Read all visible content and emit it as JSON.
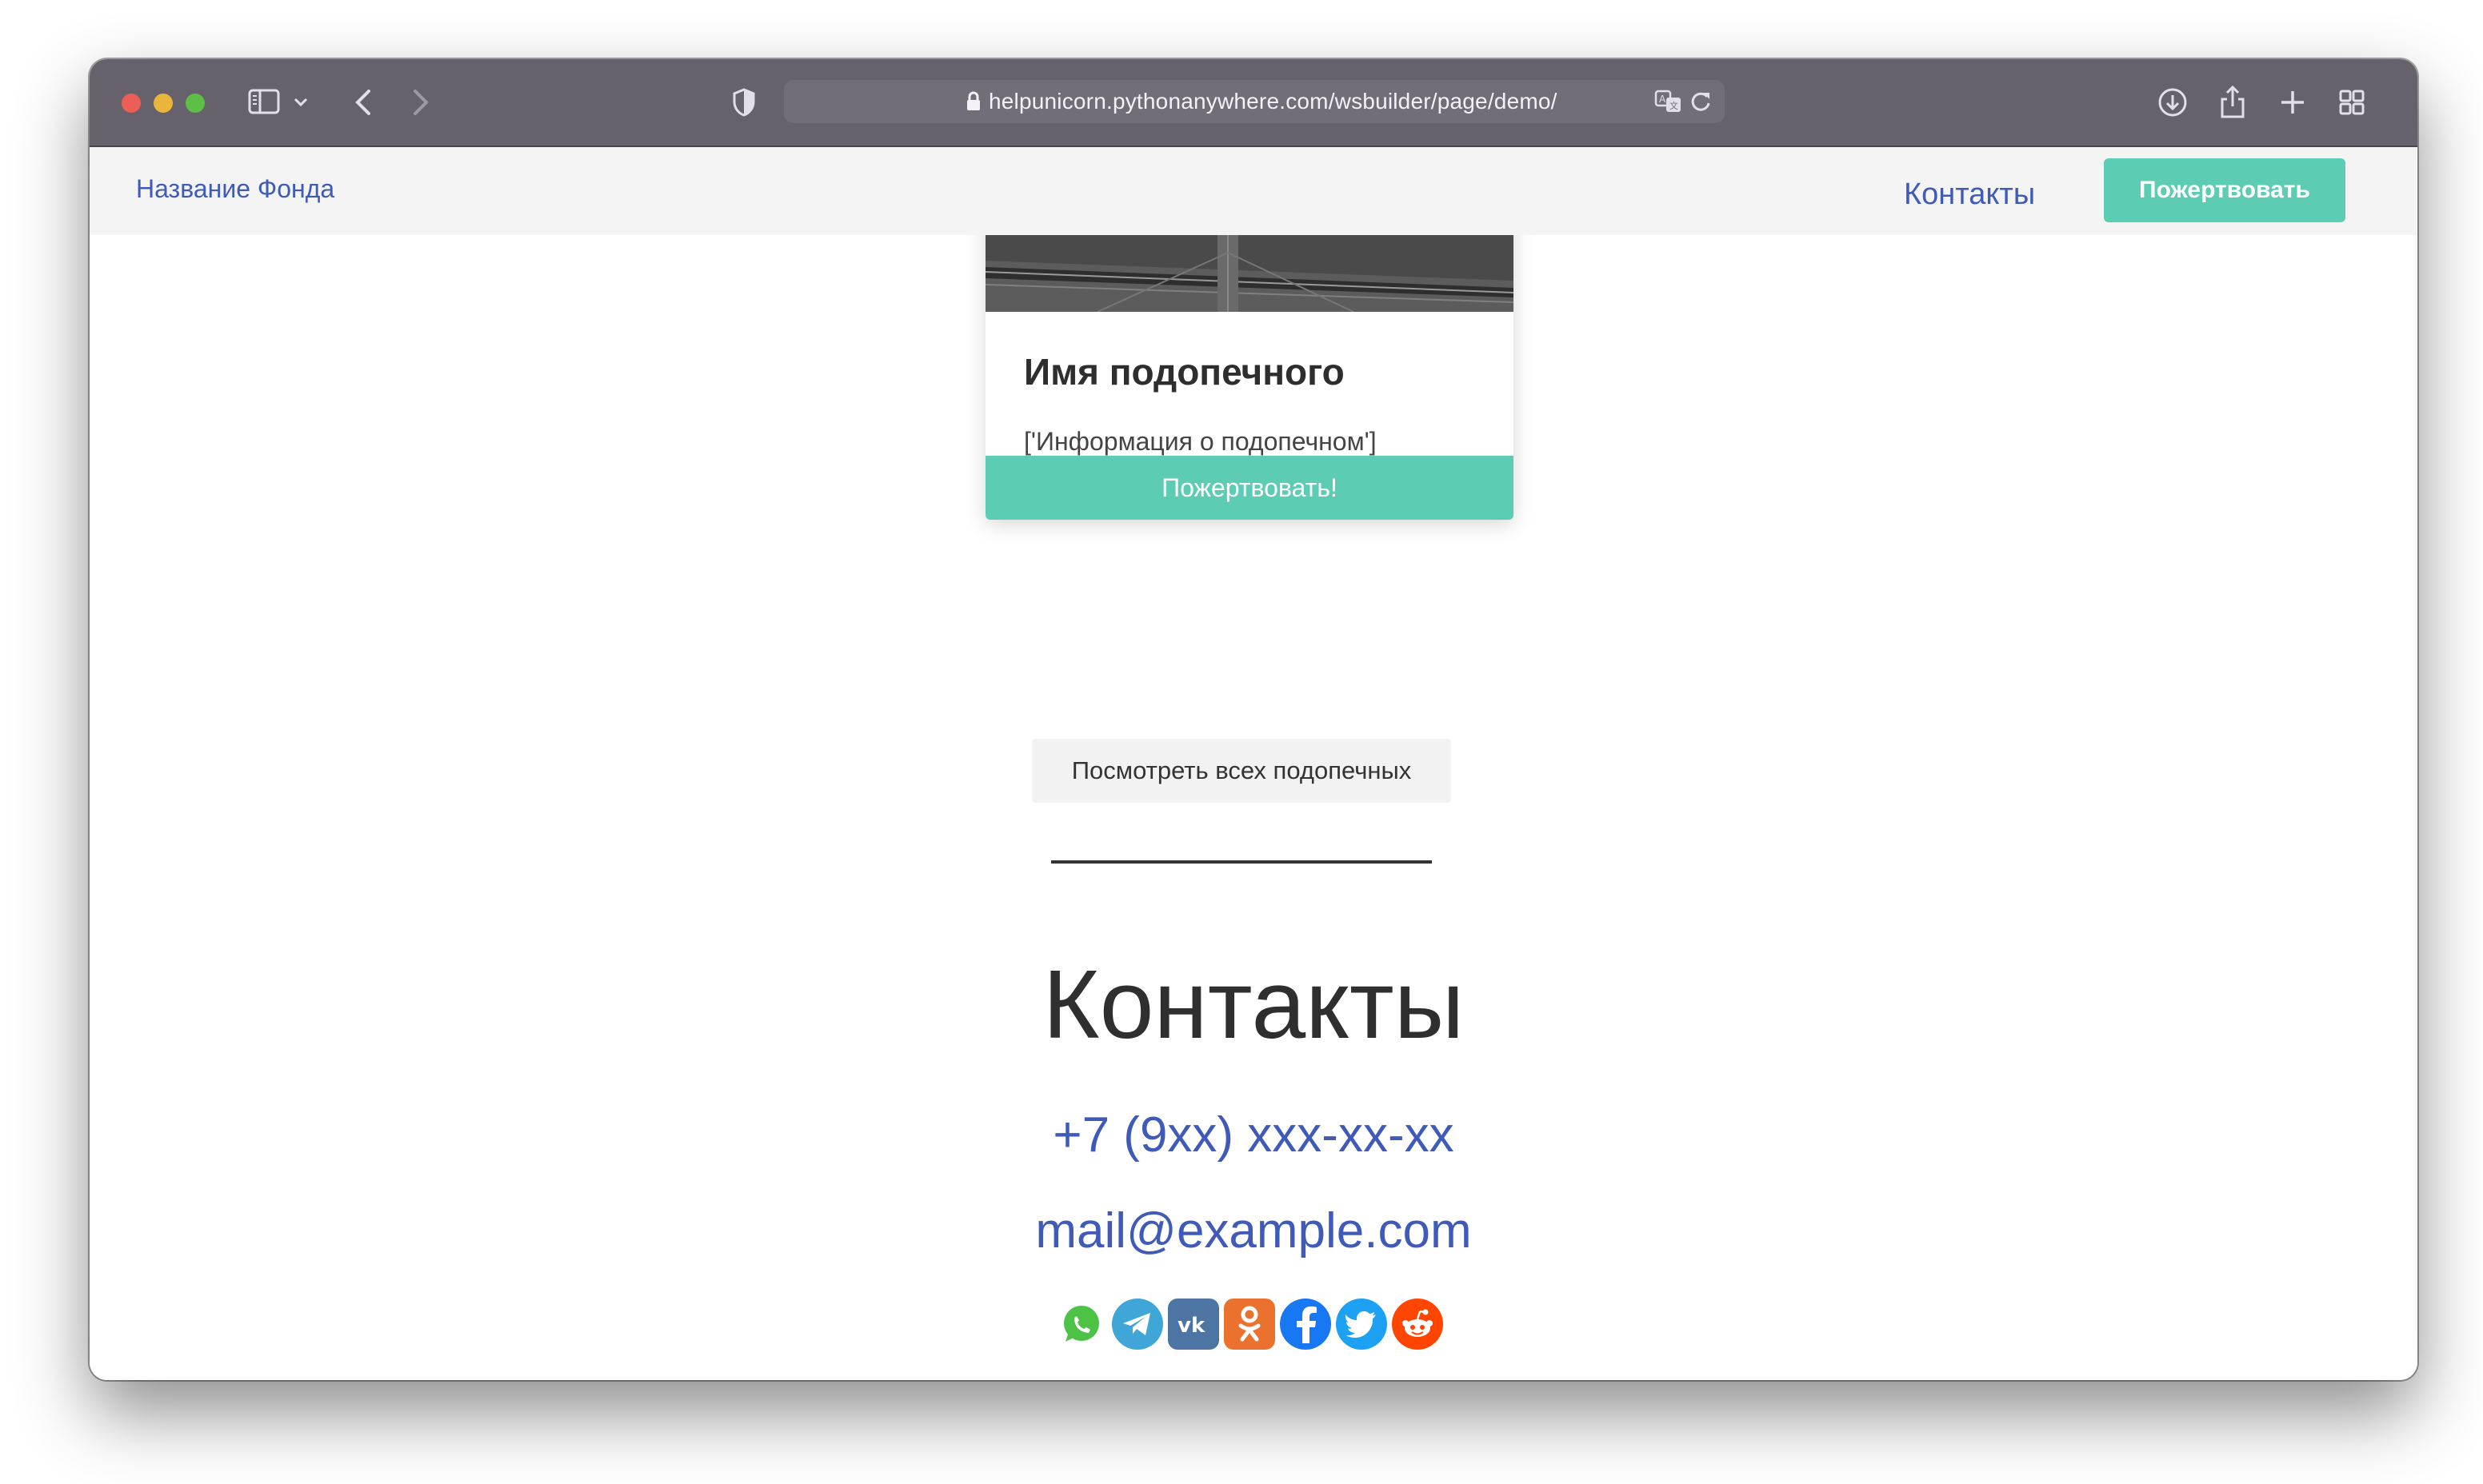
{
  "browser": {
    "url": "helpunicorn.pythonanywhere.com/wsbuilder/page/demo/",
    "icons": {
      "sidebar": "sidebar-icon",
      "back": "chevron-left-icon",
      "forward": "chevron-right-icon",
      "privacy": "shield-icon",
      "lock": "lock-icon",
      "translate": "translate-icon",
      "reload": "reload-icon",
      "download": "download-icon",
      "share": "share-icon",
      "new_tab": "plus-icon",
      "tab_overview": "tab-grid-icon"
    }
  },
  "nav": {
    "brand": "Название Фонда",
    "contacts": "Контакты",
    "donate": "Пожертвовать"
  },
  "card": {
    "title": "Имя подопечного",
    "info": "['Информация о подопечном']",
    "donate_button": "Пожертвовать!"
  },
  "view_all": "Посмотреть всех подопечных",
  "contacts": {
    "title": "Контакты",
    "phone": "+7 (9xx) xxx-xx-xx",
    "email": "mail@example.com"
  },
  "socials": [
    {
      "name": "whatsapp-icon",
      "color": "#4dc247"
    },
    {
      "name": "telegram-icon",
      "color": "#40a6d8"
    },
    {
      "name": "vk-icon",
      "color": "#4c75a3"
    },
    {
      "name": "odnoklassniki-icon",
      "color": "#eb722e"
    },
    {
      "name": "facebook-icon",
      "color": "#1877f2"
    },
    {
      "name": "twitter-icon",
      "color": "#1da1f2"
    },
    {
      "name": "reddit-icon",
      "color": "#ff4500"
    }
  ],
  "colors": {
    "accent": "#5ccdb3",
    "link": "#3f5ab8",
    "toolbar": "#66616a"
  }
}
